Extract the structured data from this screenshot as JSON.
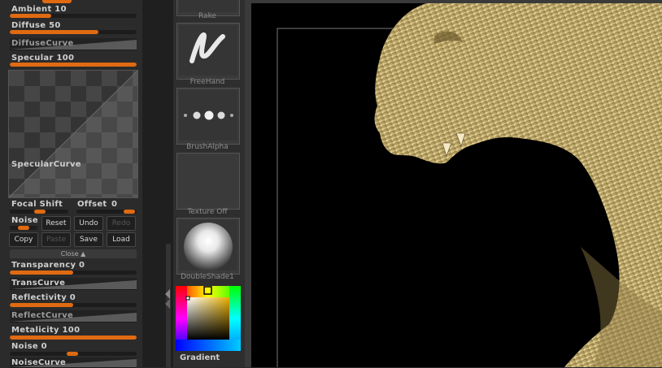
{
  "material_palette": {
    "ambient": {
      "label": "Ambient 10",
      "level": 0.33
    },
    "diffuse": {
      "label": "Diffuse 50",
      "level": 0.7
    },
    "diffuse_curve_label": "DiffuseCurve",
    "specular": {
      "label": "Specular 100",
      "level": 1.0
    },
    "specular_curve_label": "SpecularCurve",
    "focal_shift_label": "Focal Shift",
    "offset_label": "Offset",
    "offset_value": "0",
    "noise_label": "Noise",
    "buttons": {
      "reset": "Reset",
      "undo": "Undo",
      "redo": "Redo",
      "copy": "Copy",
      "paste": "Paste",
      "save": "Save",
      "load": "Load"
    },
    "close_label": "Close",
    "transparency": {
      "label": "Transparency 0",
      "level": 0.5
    },
    "trans_curve_label": "TransCurve",
    "reflectivity": {
      "label": "Reflectivity 0",
      "level": 0.5
    },
    "reflect_curve_label": "ReflectCurve",
    "metalicity": {
      "label": "Metalicity 100",
      "level": 1.0
    },
    "noise2": {
      "label": "Noise 0"
    },
    "noise_curve_label": "NoiseCurve"
  },
  "tool_column": {
    "rake_label": "Rake",
    "freehand_label": "FreeHand",
    "brushalpha_label": "BrushAlpha",
    "texture_label": "Texture  Off",
    "material_label": "DoubleShade1",
    "gradient_label": "Gradient"
  },
  "colors": {
    "accent": "#e06a12",
    "model": "#d9c383",
    "panel": "#2b2b2b",
    "canvas": "#000000"
  }
}
